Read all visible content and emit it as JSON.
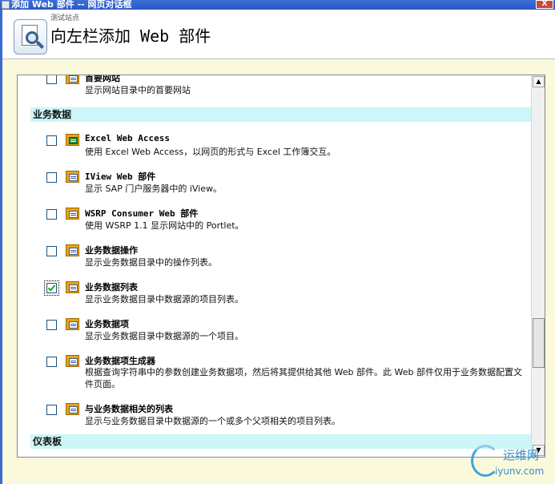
{
  "window": {
    "title": "添加 Web 部件 -- 网页对话框",
    "close_label": "X"
  },
  "header": {
    "site_name": "测试站点",
    "title": "向左栏添加 Web 部件",
    "logo_icon": "web-part-magnifier-icon"
  },
  "list": {
    "partial_item": {
      "name": "首要网站",
      "description": "显示网站目录中的首要网站"
    },
    "sections": [
      {
        "label": "业务数据",
        "items": [
          {
            "name": "Excel Web Access",
            "description": "使用 Excel Web Access，以网页的形式与 Excel 工作簿交互。",
            "icon": "excel-webpart-icon",
            "checked": false
          },
          {
            "name": "IView Web 部件",
            "description": "显示 SAP 门户服务器中的 iView。",
            "icon": "webpart-icon",
            "checked": false
          },
          {
            "name": "WSRP Consumer Web 部件",
            "description": "使用 WSRP 1.1 显示网站中的 Portlet。",
            "icon": "webpart-icon",
            "checked": false
          },
          {
            "name": "业务数据操作",
            "description": "显示业务数据目录中的操作列表。",
            "icon": "webpart-icon",
            "checked": false
          },
          {
            "name": "业务数据列表",
            "description": "显示业务数据目录中数据源的项目列表。",
            "icon": "webpart-icon",
            "checked": true
          },
          {
            "name": "业务数据项",
            "description": "显示业务数据目录中数据源的一个项目。",
            "icon": "webpart-icon",
            "checked": false
          },
          {
            "name": "业务数据项生成器",
            "description": "根据查询字符串中的参数创建业务数据项，然后将其提供给其他 Web 部件。此 Web 部件仅用于业务数据配置文件页面。",
            "icon": "webpart-icon",
            "checked": false
          },
          {
            "name": "与业务数据相关的列表",
            "description": "显示与业务数据目录中数据源的一个或多个父项相关的项目列表。",
            "icon": "webpart-icon",
            "checked": false
          }
        ]
      },
      {
        "label": "仪表板",
        "items": []
      }
    ]
  },
  "watermark": {
    "cn": "运维网",
    "en": "iyunv.com"
  }
}
